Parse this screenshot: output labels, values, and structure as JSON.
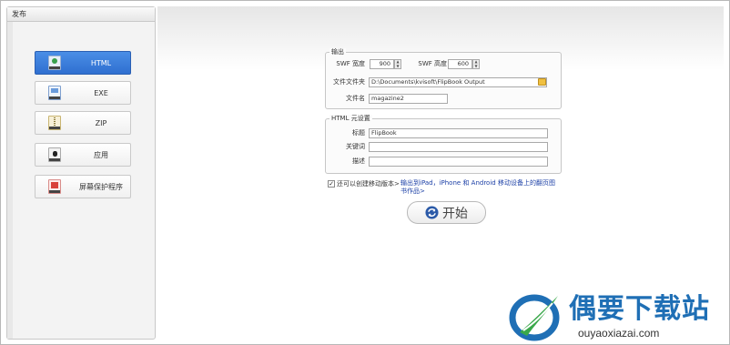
{
  "sidebar": {
    "title": "发布",
    "items": [
      {
        "label": "HTML",
        "icon": "html-icon",
        "active": true
      },
      {
        "label": "EXE",
        "icon": "exe-icon",
        "active": false
      },
      {
        "label": "ZIP",
        "icon": "zip-icon",
        "active": false
      },
      {
        "label": "应用",
        "icon": "apple-icon",
        "active": false
      },
      {
        "label": "屏幕保护程序",
        "icon": "screensaver-icon",
        "active": false
      }
    ]
  },
  "output": {
    "title": "输出",
    "swf_width_label": "SWF 宽度",
    "swf_width_value": "900",
    "swf_height_label": "SWF 高度",
    "swf_height_value": "600",
    "folder_label": "文件文件夹",
    "folder_value": "D:\\Documents\\kvisoft\\FlipBook Output",
    "filename_label": "文件名",
    "filename_value": "magazine2"
  },
  "html_meta": {
    "title": "HTML 元设置",
    "title_label": "标题",
    "title_value": "FlipBook",
    "keywords_label": "关键词",
    "keywords_value": "",
    "description_label": "描述",
    "description_value": ""
  },
  "mobile": {
    "checkbox_label": "还可以创建移动版本>",
    "checked": true,
    "link_text": "输出到iPad，iPhone 和 Android 移动设备上的翻页图书作品>"
  },
  "start_button": {
    "label": "开始"
  },
  "watermark": {
    "name": "偶要下载站",
    "url": "ouyaoxiazai.com"
  },
  "colors": {
    "accent": "#2f6fd0",
    "brand": "#1f6fb5",
    "link": "#1b3fa6"
  }
}
